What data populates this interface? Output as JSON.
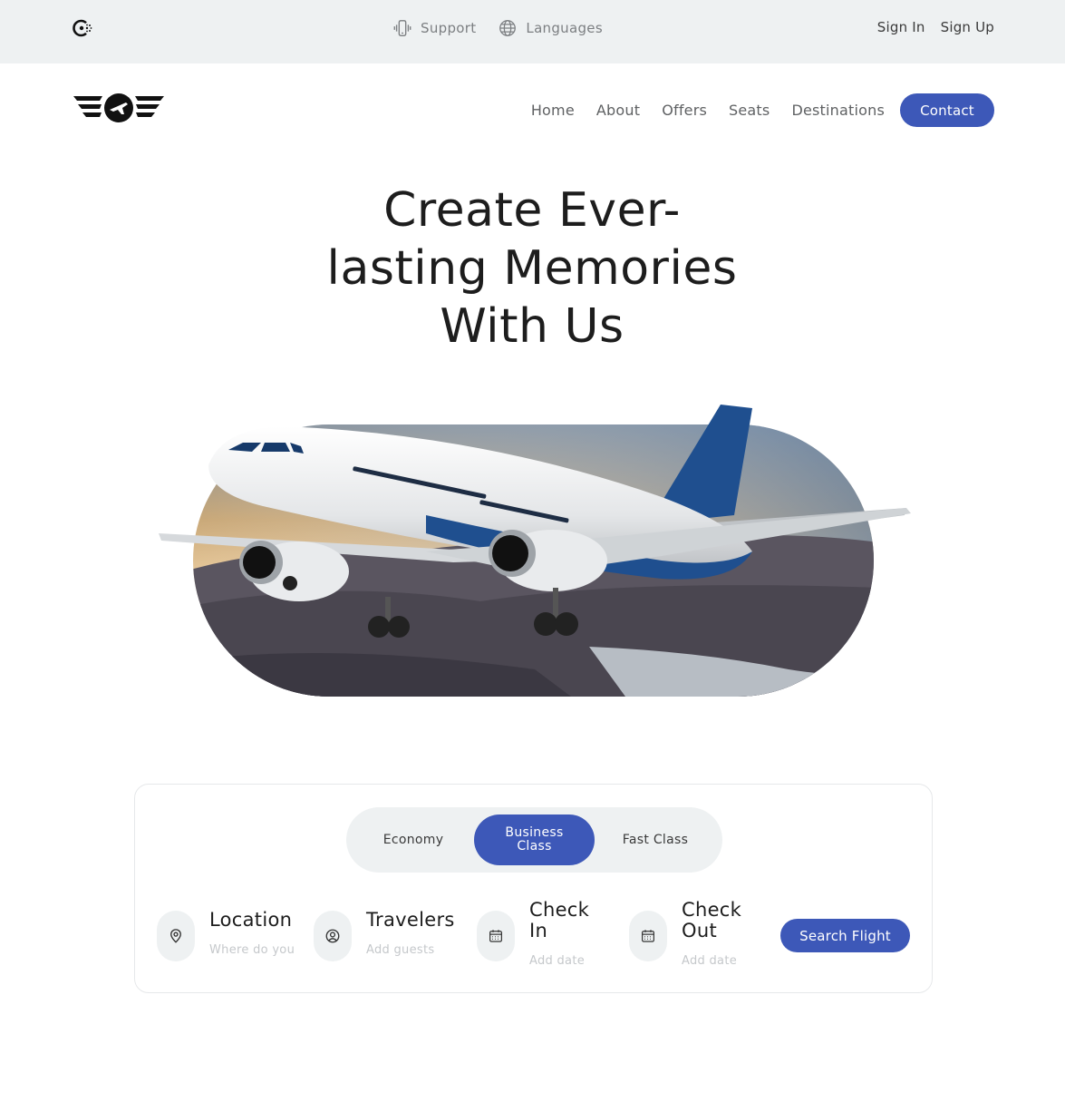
{
  "topbar": {
    "support_label": "Support",
    "languages_label": "Languages",
    "sign_in": "Sign In",
    "sign_up": "Sign Up"
  },
  "nav": {
    "items": [
      {
        "label": "Home"
      },
      {
        "label": "About"
      },
      {
        "label": "Offers"
      },
      {
        "label": "Seats"
      },
      {
        "label": "Destinations"
      }
    ],
    "contact_label": "Contact"
  },
  "hero": {
    "title": "Create Ever-lasting Memories With Us"
  },
  "search": {
    "tabs": [
      {
        "label": "Economy",
        "selected": false
      },
      {
        "label": "Business Class",
        "selected": true
      },
      {
        "label": "Fast Class",
        "selected": false
      }
    ],
    "fields": [
      {
        "label": "Location",
        "placeholder": "Where do you",
        "icon": "location-pin-icon"
      },
      {
        "label": "Travelers",
        "placeholder": "Add guests",
        "icon": "user-icon"
      },
      {
        "label": "Check In",
        "placeholder": "Add date",
        "icon": "calendar-icon"
      },
      {
        "label": "Check Out",
        "placeholder": "Add date",
        "icon": "calendar-icon"
      }
    ],
    "button_label": "Search Flight"
  },
  "colors": {
    "accent": "#3d58b8",
    "topbar_bg": "#eef1f2"
  }
}
